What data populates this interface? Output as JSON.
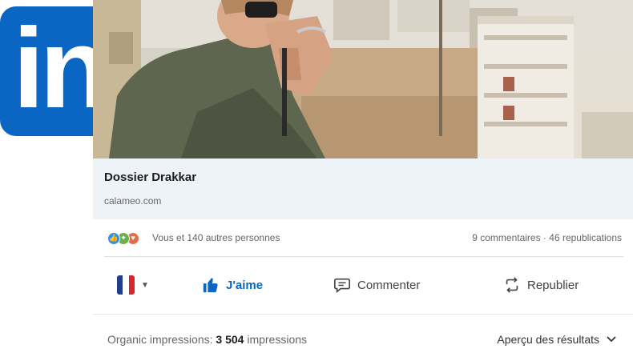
{
  "logo": {
    "text": "in",
    "color": "#0a66c2"
  },
  "post": {
    "link_title": "Dossier Drakkar",
    "link_domain": "calameo.com",
    "reactions_text": "Vous et 140 autres personnes",
    "stats_text": "9 commentaires · 46 republications",
    "actions": {
      "like_label": "J'aime",
      "comment_label": "Commenter",
      "repost_label": "Republier"
    },
    "impressions_label": "Organic impressions:",
    "impressions_count": "3 504",
    "impressions_unit": "impressions",
    "results_label": "Aperçu des résultats"
  },
  "icons": {
    "reactions": [
      "like-reaction-icon",
      "celebrate-reaction-icon",
      "love-reaction-icon"
    ],
    "flag": "french-flag-icon",
    "like": "thumbs-up-icon",
    "comment": "speech-bubble-icon",
    "repost": "repost-arrows-icon",
    "chevron": "chevron-down-icon"
  },
  "colors": {
    "brand": "#0a66c2",
    "link_box_bg": "#eef3f8",
    "like_active": "#0a66c2",
    "flag": [
      "#1f3e8c",
      "#ffffff",
      "#d8262c"
    ]
  }
}
